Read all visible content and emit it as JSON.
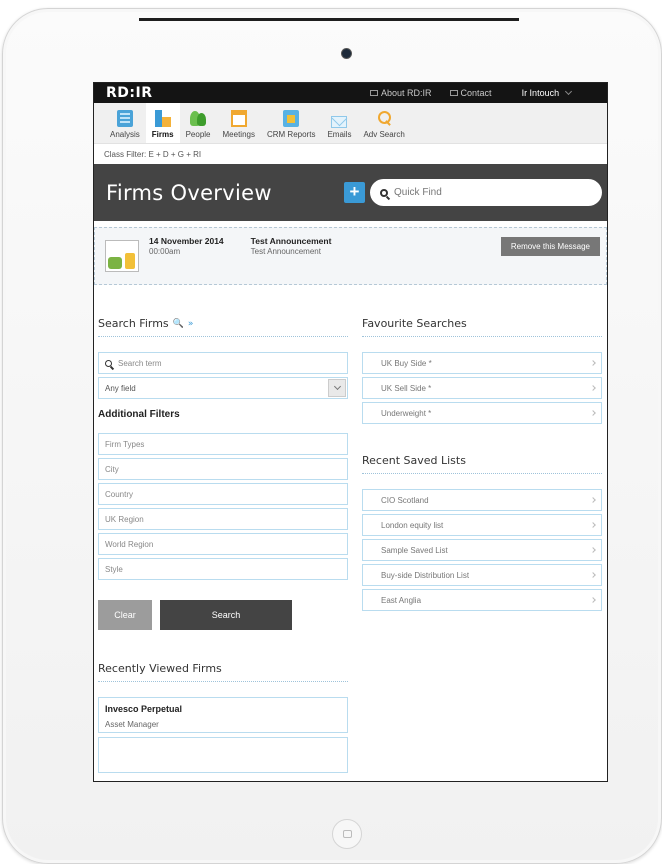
{
  "topbar": {
    "logo": "RD:IR",
    "about": "About RD:IR",
    "contact": "Contact",
    "user": "Ir Intouch"
  },
  "nav": [
    {
      "label": "Analysis",
      "icon": "analysis-icon"
    },
    {
      "label": "Firms",
      "icon": "firms-icon",
      "active": true
    },
    {
      "label": "People",
      "icon": "people-icon"
    },
    {
      "label": "Meetings",
      "icon": "calendar-icon"
    },
    {
      "label": "CRM Reports",
      "icon": "crm-reports-icon"
    },
    {
      "label": "Emails",
      "icon": "envelope-icon"
    },
    {
      "label": "Adv Search",
      "icon": "search-icon"
    }
  ],
  "class_filter": "Class Filter: E + D + G + RI",
  "header": {
    "title": "Firms Overview",
    "plus": "+",
    "quick_find_placeholder": "Quick Find"
  },
  "announcement": {
    "date": "14 November 2014",
    "time": "00:00am",
    "title": "Test Announcement",
    "body": "Test Announcement",
    "remove_label": "Remove this Message"
  },
  "search": {
    "title": "Search Firms",
    "title_suffix": "»",
    "term_placeholder": "Search term",
    "field_select": "Any field",
    "additional_filters": "Additional Filters",
    "filters": [
      "Firm Types",
      "City",
      "Country",
      "UK Region",
      "World Region",
      "Style"
    ],
    "clear_label": "Clear",
    "search_label": "Search"
  },
  "recent_firms": {
    "title": "Recently Viewed Firms",
    "items": [
      {
        "name": "Invesco Perpetual",
        "type": "Asset Manager"
      }
    ]
  },
  "favourites": {
    "title": "Favourite Searches",
    "items": [
      "UK Buy Side *",
      "UK Sell Side *",
      "Underweight *"
    ]
  },
  "saved_lists": {
    "title": "Recent Saved Lists",
    "items": [
      "CIO Scotland",
      "London equity list",
      "Sample Saved List",
      "Buy-side Distribution List",
      "East Anglia"
    ]
  },
  "colors": {
    "accent": "#3a9ad6",
    "header_bg": "#444444",
    "topbar_bg": "#141414"
  }
}
